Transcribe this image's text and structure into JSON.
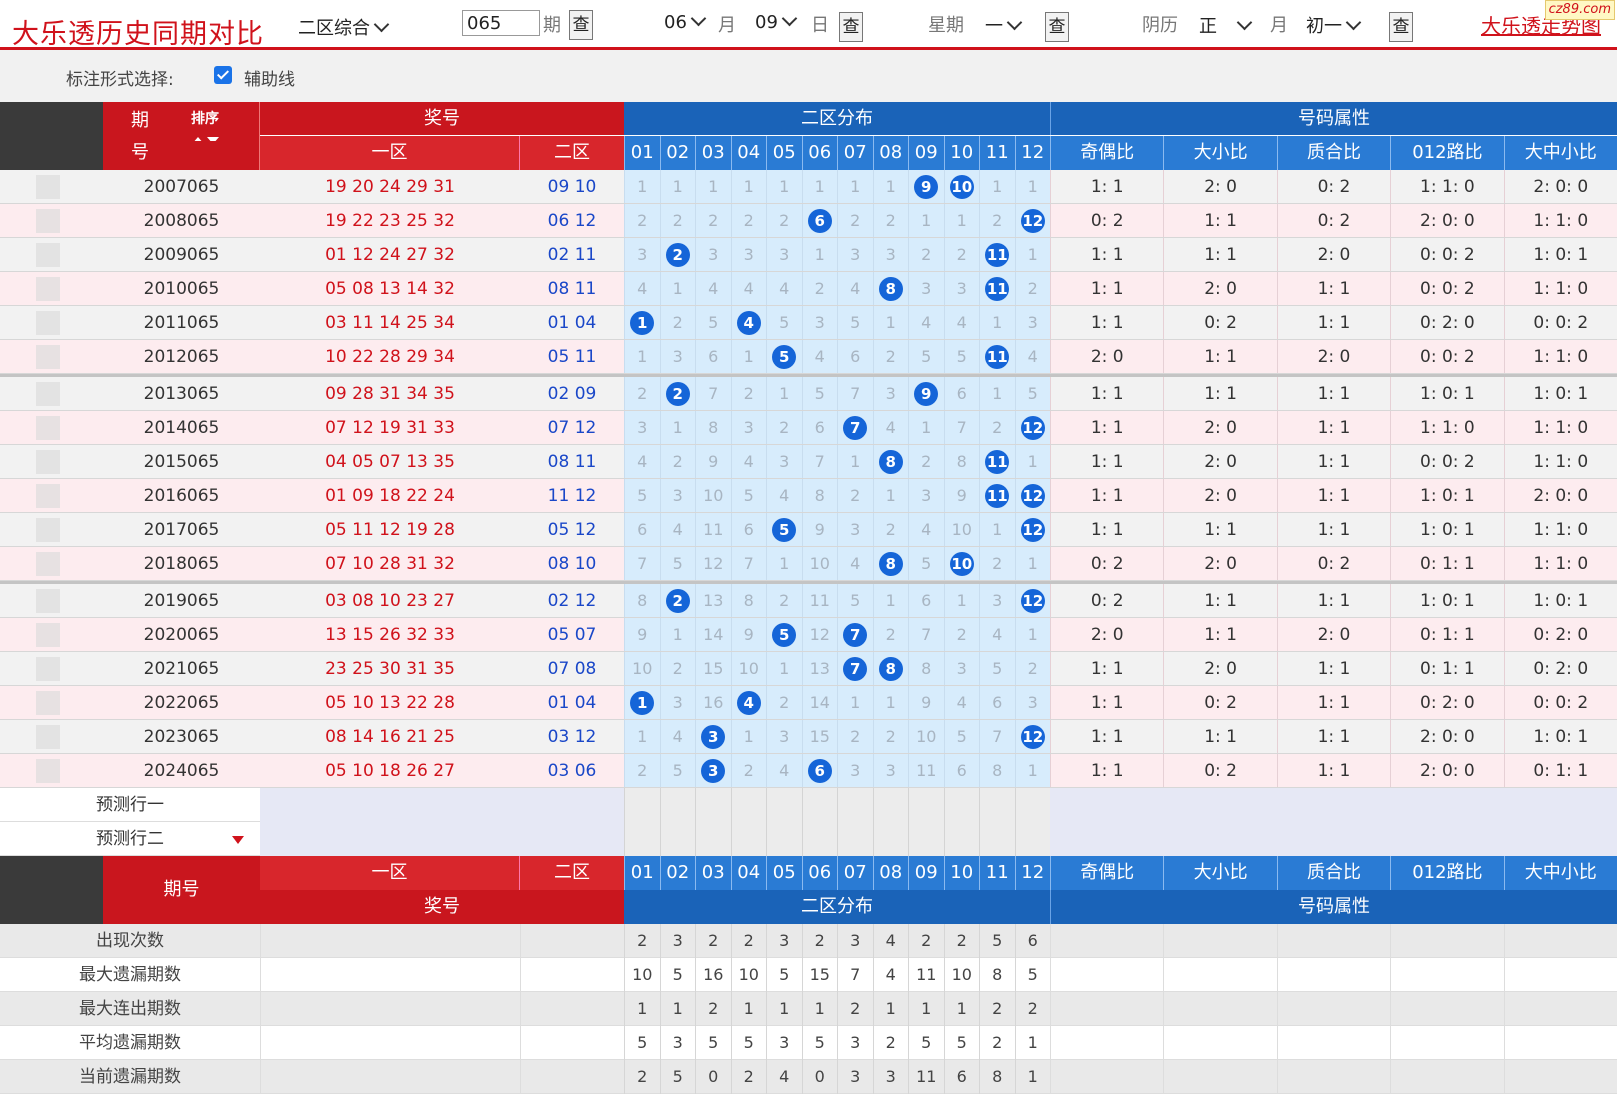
{
  "header": {
    "title": "大乐透历史同期对比",
    "mode_select": "二区综合",
    "period_value": "065",
    "period_label": "期",
    "query": "查",
    "month_value": "06",
    "month_label": "月",
    "day_value": "09",
    "day_label": "日",
    "weekday_label": "星期",
    "weekday_value": "一",
    "lunar_label": "阴历",
    "lunar_month_value": "正",
    "lunar_month_label": "月",
    "lunar_day_value": "初一",
    "link": "大乐透走势图",
    "logo": "cz89.com"
  },
  "options": {
    "label": "标注形式选择:",
    "aux_line": "辅助线"
  },
  "columns": {
    "period1": "期",
    "period2": "号",
    "sort": "排序",
    "award": "奖号",
    "zone1": "一区",
    "zone2": "二区",
    "dist": "二区分布",
    "attr": "号码属性",
    "nums": [
      "01",
      "02",
      "03",
      "04",
      "05",
      "06",
      "07",
      "08",
      "09",
      "10",
      "11",
      "12"
    ],
    "attrs": [
      "奇偶比",
      "大小比",
      "质合比",
      "012路比",
      "大中小比"
    ],
    "period_full": "期号"
  },
  "rows": [
    {
      "issue": "2007065",
      "z1": "19  20  24  29  31",
      "z2": "09  10",
      "d": [
        1,
        1,
        1,
        1,
        1,
        1,
        1,
        1,
        "9",
        "10",
        1,
        1
      ],
      "a": [
        "1:  1",
        "2:  0",
        "0:  2",
        "1:  1:  0",
        "2:  0:  0"
      ]
    },
    {
      "issue": "2008065",
      "z1": "19  22  23  25  32",
      "z2": "06  12",
      "d": [
        2,
        2,
        2,
        2,
        2,
        "6",
        2,
        2,
        1,
        1,
        2,
        "12"
      ],
      "a": [
        "0:  2",
        "1:  1",
        "0:  2",
        "2:  0:  0",
        "1:  1:  0"
      ]
    },
    {
      "issue": "2009065",
      "z1": "01  12  24  27  32",
      "z2": "02  11",
      "d": [
        3,
        "2",
        3,
        3,
        3,
        1,
        3,
        3,
        2,
        2,
        "11",
        1
      ],
      "a": [
        "1:  1",
        "1:  1",
        "2:  0",
        "0:  0:  2",
        "1:  0:  1"
      ]
    },
    {
      "issue": "2010065",
      "z1": "05  08  13  14  32",
      "z2": "08  11",
      "d": [
        4,
        1,
        4,
        4,
        4,
        2,
        4,
        "8",
        3,
        3,
        "11",
        2
      ],
      "a": [
        "1:  1",
        "2:  0",
        "1:  1",
        "0:  0:  2",
        "1:  1:  0"
      ]
    },
    {
      "issue": "2011065",
      "z1": "03  11  14  25  34",
      "z2": "01  04",
      "d": [
        "1",
        2,
        5,
        "4",
        5,
        3,
        5,
        1,
        4,
        4,
        1,
        3
      ],
      "a": [
        "1:  1",
        "0:  2",
        "1:  1",
        "0:  2:  0",
        "0:  0:  2"
      ]
    },
    {
      "issue": "2012065",
      "z1": "10  22  28  29  34",
      "z2": "05  11",
      "d": [
        1,
        3,
        6,
        1,
        "5",
        4,
        6,
        2,
        5,
        5,
        "11",
        4
      ],
      "a": [
        "2:  0",
        "1:  1",
        "2:  0",
        "0:  0:  2",
        "1:  1:  0"
      ]
    },
    {
      "issue": "2013065",
      "z1": "09  28  31  34  35",
      "z2": "02  09",
      "d": [
        2,
        "2",
        7,
        2,
        1,
        5,
        7,
        3,
        "9",
        6,
        1,
        5
      ],
      "a": [
        "1:  1",
        "1:  1",
        "1:  1",
        "1:  0:  1",
        "1:  0:  1"
      ]
    },
    {
      "issue": "2014065",
      "z1": "07  12  19  31  33",
      "z2": "07  12",
      "d": [
        3,
        1,
        8,
        3,
        2,
        6,
        "7",
        4,
        1,
        7,
        2,
        "12"
      ],
      "a": [
        "1:  1",
        "2:  0",
        "1:  1",
        "1:  1:  0",
        "1:  1:  0"
      ]
    },
    {
      "issue": "2015065",
      "z1": "04  05  07  13  35",
      "z2": "08  11",
      "d": [
        4,
        2,
        9,
        4,
        3,
        7,
        1,
        "8",
        2,
        8,
        "11",
        1
      ],
      "a": [
        "1:  1",
        "2:  0",
        "1:  1",
        "0:  0:  2",
        "1:  1:  0"
      ]
    },
    {
      "issue": "2016065",
      "z1": "01  09  18  22  24",
      "z2": "11  12",
      "d": [
        5,
        3,
        10,
        5,
        4,
        8,
        2,
        1,
        3,
        9,
        "11",
        "12"
      ],
      "a": [
        "1:  1",
        "2:  0",
        "1:  1",
        "1:  0:  1",
        "2:  0:  0"
      ]
    },
    {
      "issue": "2017065",
      "z1": "05  11  12  19  28",
      "z2": "05  12",
      "d": [
        6,
        4,
        11,
        6,
        "5",
        9,
        3,
        2,
        4,
        10,
        1,
        "12"
      ],
      "a": [
        "1:  1",
        "1:  1",
        "1:  1",
        "1:  0:  1",
        "1:  1:  0"
      ]
    },
    {
      "issue": "2018065",
      "z1": "07  10  28  31  32",
      "z2": "08  10",
      "d": [
        7,
        5,
        12,
        7,
        1,
        10,
        4,
        "8",
        5,
        "10",
        2,
        1
      ],
      "a": [
        "0:  2",
        "2:  0",
        "0:  2",
        "0:  1:  1",
        "1:  1:  0"
      ]
    },
    {
      "issue": "2019065",
      "z1": "03  08  10  23  27",
      "z2": "02  12",
      "d": [
        8,
        "2",
        13,
        8,
        2,
        11,
        5,
        1,
        6,
        1,
        3,
        "12"
      ],
      "a": [
        "0:  2",
        "1:  1",
        "1:  1",
        "1:  0:  1",
        "1:  0:  1"
      ]
    },
    {
      "issue": "2020065",
      "z1": "13  15  26  32  33",
      "z2": "05  07",
      "d": [
        9,
        1,
        14,
        9,
        "5",
        12,
        "7",
        2,
        7,
        2,
        4,
        1
      ],
      "a": [
        "2:  0",
        "1:  1",
        "2:  0",
        "0:  1:  1",
        "0:  2:  0"
      ]
    },
    {
      "issue": "2021065",
      "z1": "23  25  30  31  35",
      "z2": "07  08",
      "d": [
        10,
        2,
        15,
        10,
        1,
        13,
        "7",
        "8",
        8,
        3,
        5,
        2
      ],
      "a": [
        "1:  1",
        "2:  0",
        "1:  1",
        "0:  1:  1",
        "0:  2:  0"
      ]
    },
    {
      "issue": "2022065",
      "z1": "05  10  13  22  28",
      "z2": "01  04",
      "d": [
        "1",
        3,
        16,
        "4",
        2,
        14,
        1,
        1,
        9,
        4,
        6,
        3
      ],
      "a": [
        "1:  1",
        "0:  2",
        "1:  1",
        "0:  2:  0",
        "0:  0:  2"
      ]
    },
    {
      "issue": "2023065",
      "z1": "08  14  16  21  25",
      "z2": "03  12",
      "d": [
        1,
        4,
        "3",
        1,
        3,
        15,
        2,
        2,
        10,
        5,
        7,
        "12"
      ],
      "a": [
        "1:  1",
        "1:  1",
        "1:  1",
        "2:  0:  0",
        "1:  0:  1"
      ]
    },
    {
      "issue": "2024065",
      "z1": "05  10  18  26  27",
      "z2": "03  06",
      "d": [
        2,
        5,
        "3",
        2,
        4,
        "6",
        3,
        3,
        11,
        6,
        8,
        1
      ],
      "a": [
        "1:  1",
        "0:  2",
        "1:  1",
        "2:  0:  0",
        "0:  1:  1"
      ]
    }
  ],
  "predict": [
    "预测行一",
    "预测行二"
  ],
  "stats": [
    {
      "label": "出现次数",
      "v": [
        2,
        3,
        2,
        2,
        3,
        2,
        3,
        4,
        2,
        2,
        5,
        6
      ]
    },
    {
      "label": "最大遗漏期数",
      "v": [
        10,
        5,
        16,
        10,
        5,
        15,
        7,
        4,
        11,
        10,
        8,
        5
      ]
    },
    {
      "label": "最大连出期数",
      "v": [
        1,
        1,
        2,
        1,
        1,
        1,
        2,
        1,
        1,
        1,
        2,
        2
      ]
    },
    {
      "label": "平均遗漏期数",
      "v": [
        5,
        3,
        5,
        5,
        3,
        5,
        3,
        2,
        5,
        5,
        2,
        1
      ]
    },
    {
      "label": "当前遗漏期数",
      "v": [
        2,
        5,
        0,
        2,
        4,
        0,
        3,
        3,
        11,
        6,
        8,
        1
      ]
    }
  ],
  "colors": {
    "accent_red": "#d0121b",
    "header_blue": "#1a63b8",
    "ball_blue": "#1565d8",
    "dist_bg": "#d7ecfc",
    "zebra_pink": "#fdecef",
    "zebra_gray": "#f2f2f2"
  }
}
